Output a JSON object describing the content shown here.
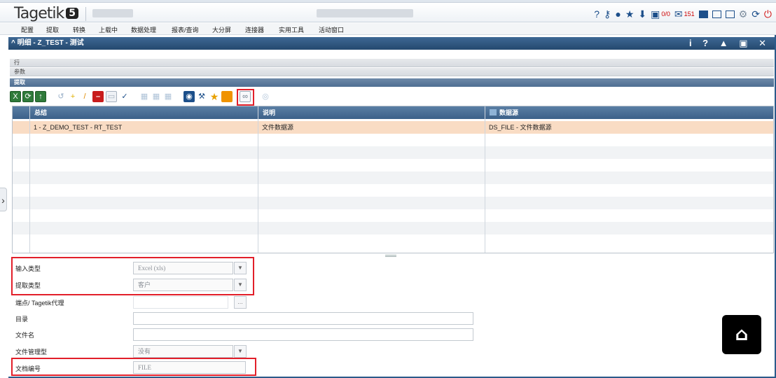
{
  "app": {
    "logo_text": "Tagetik",
    "logo_version": "5"
  },
  "header_icons": [
    {
      "name": "help-icon",
      "glyph": "?"
    },
    {
      "name": "key-icon",
      "glyph": "⚷"
    },
    {
      "name": "user-icon",
      "glyph": "👤"
    },
    {
      "name": "star-icon",
      "glyph": "★"
    },
    {
      "name": "download-icon",
      "glyph": "⬇"
    },
    {
      "name": "monitor-icon",
      "glyph": "▣"
    }
  ],
  "header_counts": {
    "tasks": "0/0",
    "messages": "151"
  },
  "menu": [
    "配置",
    "提取",
    "转换",
    "上载中",
    "数据处理",
    "报表/查询",
    "大分屏",
    "连接器",
    "实用工具",
    "活动窗口"
  ],
  "panel": {
    "title": "明细 - Z_TEST - 测试",
    "tools": "i ? ▲ ▣ ✕"
  },
  "strips": {
    "row": "行",
    "params": "参数",
    "extract": "提取"
  },
  "grid": {
    "columns": [
      "总结",
      "说明",
      "数据源"
    ],
    "rows": [
      [
        "1 - Z_DEMO_TEST - RT_TEST",
        "文件数据源",
        "DS_FILE - 文件数据源"
      ]
    ]
  },
  "form": {
    "input_type_label": "输入类型",
    "input_type_value": "Excel (xls)",
    "extract_type_label": "提取类型",
    "extract_type_value": "客户",
    "endpoint_label": "端点/ Tagetik代理",
    "directory_label": "目录",
    "filename_label": "文件名",
    "file_mgmt_label": "文件管理型",
    "file_mgmt_value": "没有",
    "doc_number_label": "文档编号",
    "doc_number_value": "FILE"
  },
  "colors": {
    "accent": "#1c4f8a",
    "highlight": "#e21f2a",
    "selected_row": "#f9dcc4"
  }
}
